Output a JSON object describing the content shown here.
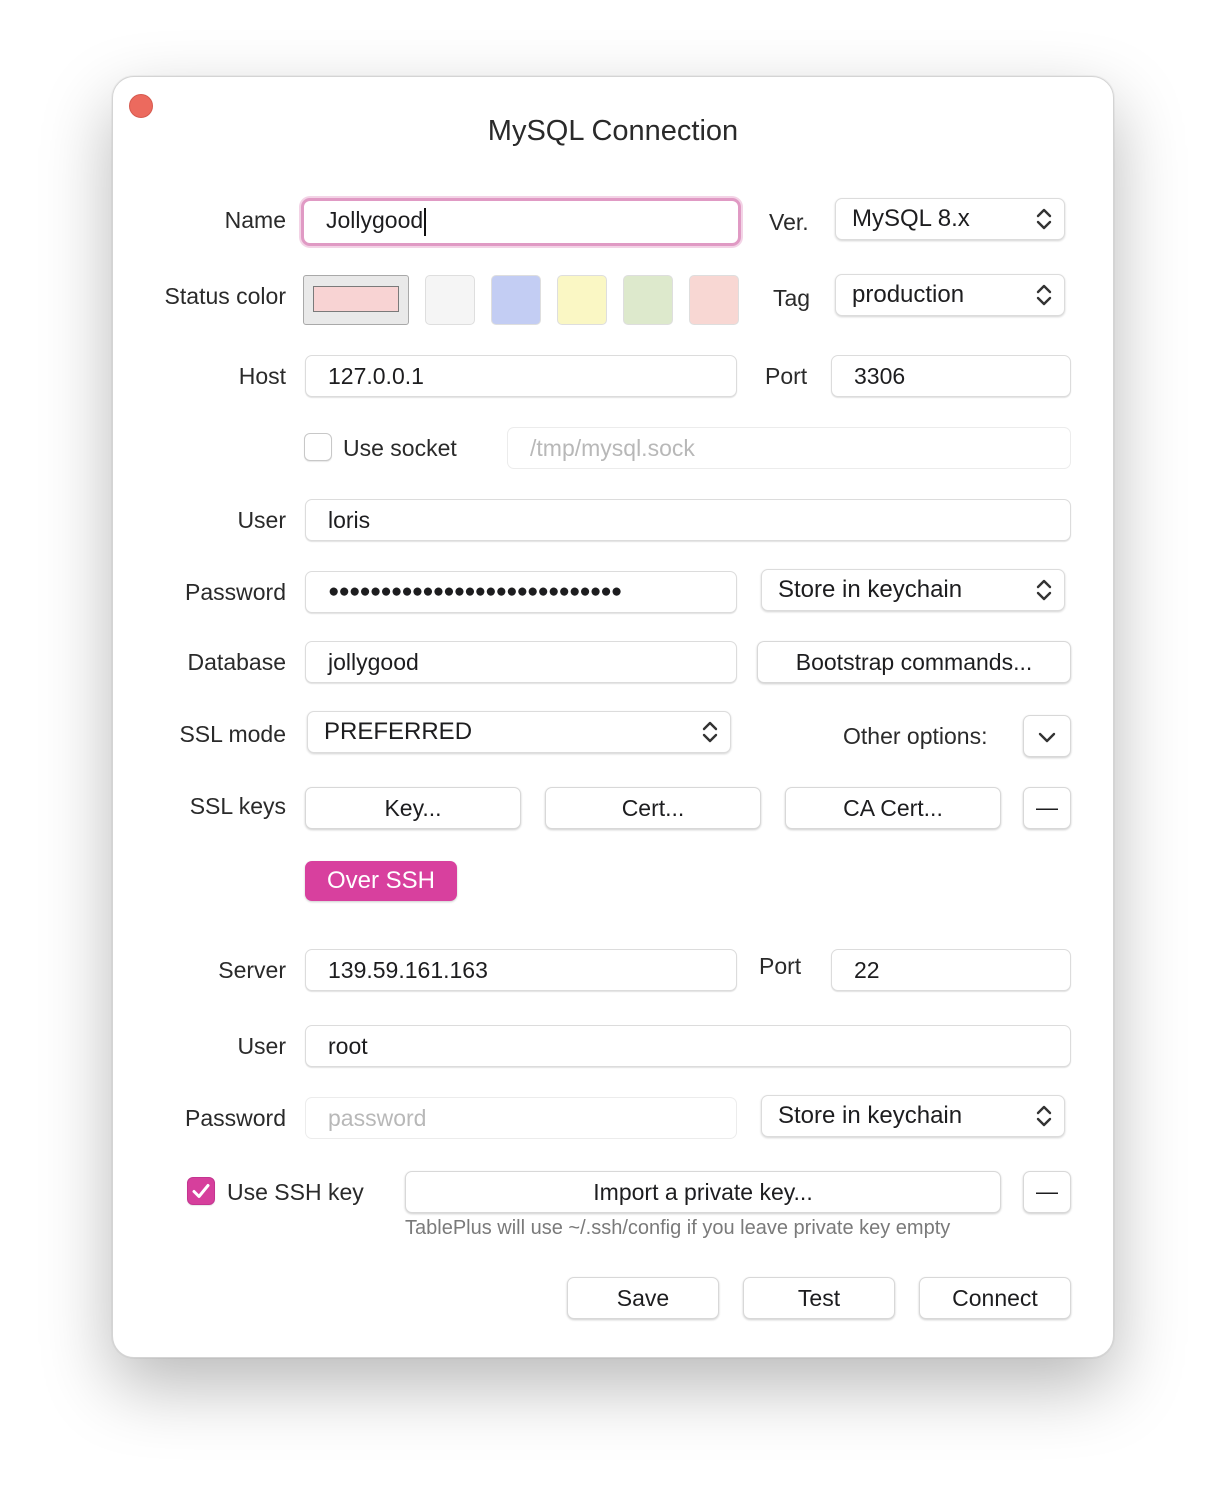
{
  "window": {
    "title": "MySQL Connection"
  },
  "form": {
    "name_label": "Name",
    "name_value": "Jollygood",
    "ver_label": "Ver.",
    "ver_value": "MySQL 8.x",
    "status_color_label": "Status color",
    "tag_label": "Tag",
    "tag_value": "production",
    "status_colors": [
      "#f8d3d3",
      "#f5f5f5",
      "#c3cdf3",
      "#faf7c4",
      "#dde9cc",
      "#f8d7d3"
    ],
    "host_label": "Host",
    "host_value": "127.0.0.1",
    "port_label": "Port",
    "port_value": "3306",
    "use_socket_label": "Use socket",
    "socket_placeholder": "/tmp/mysql.sock",
    "user_label": "User",
    "user_value": "loris",
    "password_label": "Password",
    "password_value": "●●●●●●●●●●●●●●●●●●●●●●●●●●●●",
    "password_store": "Store in keychain",
    "database_label": "Database",
    "database_value": "jollygood",
    "bootstrap_label": "Bootstrap commands...",
    "ssl_mode_label": "SSL mode",
    "ssl_mode_value": "PREFERRED",
    "other_options_label": "Other options:",
    "ssl_keys_label": "SSL keys",
    "key_button": "Key...",
    "cert_button": "Cert...",
    "ca_cert_button": "CA Cert...",
    "minus": "—"
  },
  "ssh": {
    "toggle_label": "Over SSH",
    "server_label": "Server",
    "server_value": "139.59.161.163",
    "port_label": "Port",
    "port_value": "22",
    "user_label": "User",
    "user_value": "root",
    "password_label": "Password",
    "password_placeholder": "password",
    "password_store": "Store in keychain",
    "use_key_label": "Use SSH key",
    "import_key_button": "Import a private key...",
    "hint": "TablePlus will use ~/.ssh/config if you leave private key empty",
    "minus": "—"
  },
  "footer": {
    "save": "Save",
    "test": "Test",
    "connect": "Connect"
  },
  "colors": {
    "accent": "#d8409e",
    "close": "#ec6a5e",
    "focus_ring": "#e09ac4"
  }
}
